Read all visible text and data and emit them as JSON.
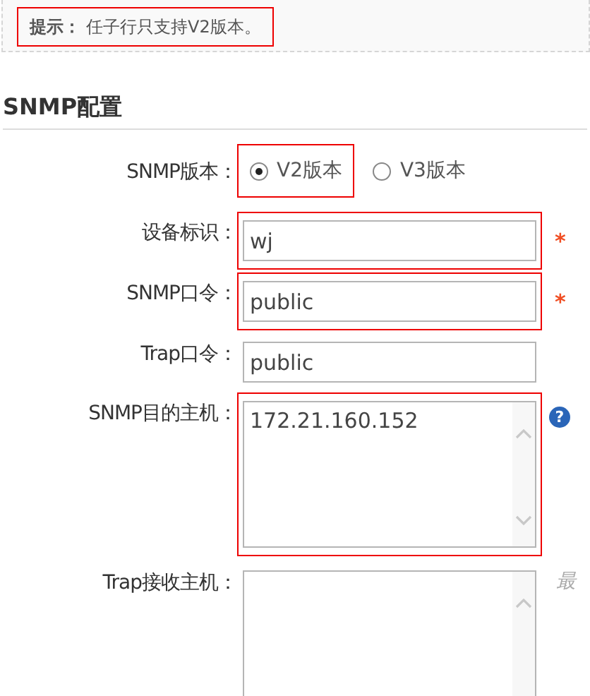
{
  "tip": {
    "label": "提示：",
    "text": "任子行只支持V2版本。",
    "highlighted": true
  },
  "section": {
    "title": "SNMP配置"
  },
  "fields": [
    {
      "kind": "radio",
      "label": "SNMP版本：",
      "options": [
        {
          "label": "V2版本",
          "selected": true,
          "highlighted": true
        },
        {
          "label": "V3版本",
          "selected": false,
          "highlighted": false
        }
      ]
    },
    {
      "kind": "text",
      "label": "设备标识：",
      "value": "wj",
      "highlighted": true,
      "required_mark": "*"
    },
    {
      "kind": "text",
      "label": "SNMP口令：",
      "value": "public",
      "highlighted": true,
      "required_mark": "*"
    },
    {
      "kind": "text",
      "label": "Trap口令：",
      "value": "public",
      "highlighted": false
    },
    {
      "kind": "textarea",
      "label": "SNMP目的主机：",
      "value": "172.21.160.152",
      "highlighted": true,
      "help": "?"
    },
    {
      "kind": "textarea",
      "label": "Trap接收主机：",
      "highlighted": false,
      "hint": "最"
    }
  ]
}
